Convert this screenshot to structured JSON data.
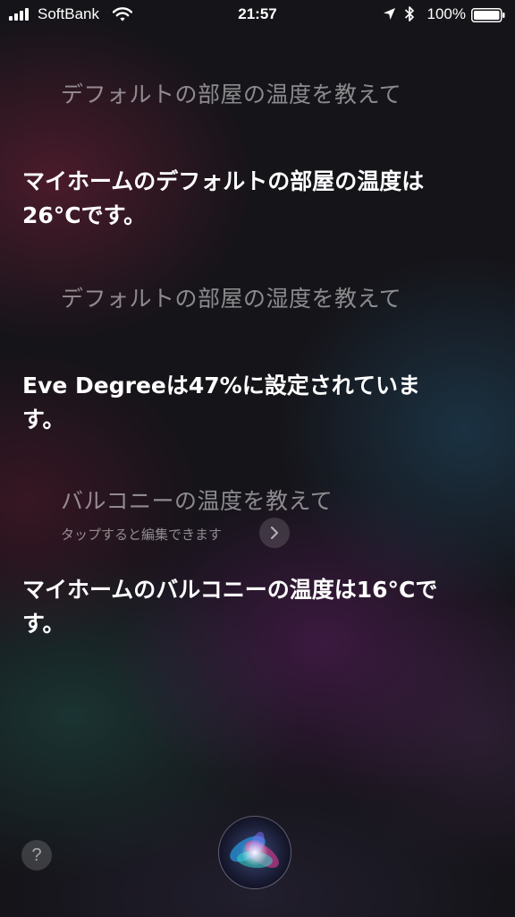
{
  "status_bar": {
    "carrier": "SoftBank",
    "time": "21:57",
    "battery_percent": "100%"
  },
  "conversation": [
    {
      "role": "query",
      "text": "デフォルトの部屋の温度を教えて"
    },
    {
      "role": "response",
      "text": "マイホームのデフォルトの部屋の温度は26°Cです。"
    },
    {
      "role": "query",
      "text": "デフォルトの部屋の湿度を教えて"
    },
    {
      "role": "response",
      "text": "Eve Degreeは47%に設定されています。"
    },
    {
      "role": "query",
      "text": "バルコニーの温度を教えて",
      "hint": "タップすると編集できます"
    },
    {
      "role": "response",
      "text": "マイホームのバルコニーの温度は16°Cです。"
    }
  ],
  "controls": {
    "help_label": "?",
    "help_icon": "question-mark-icon",
    "siri_icon": "siri-orb-icon",
    "edit_icon": "chevron-right-icon"
  },
  "colors": {
    "text": "#ffffff",
    "query_text": "rgba(255,255,255,0.5)",
    "background": "#151419"
  }
}
